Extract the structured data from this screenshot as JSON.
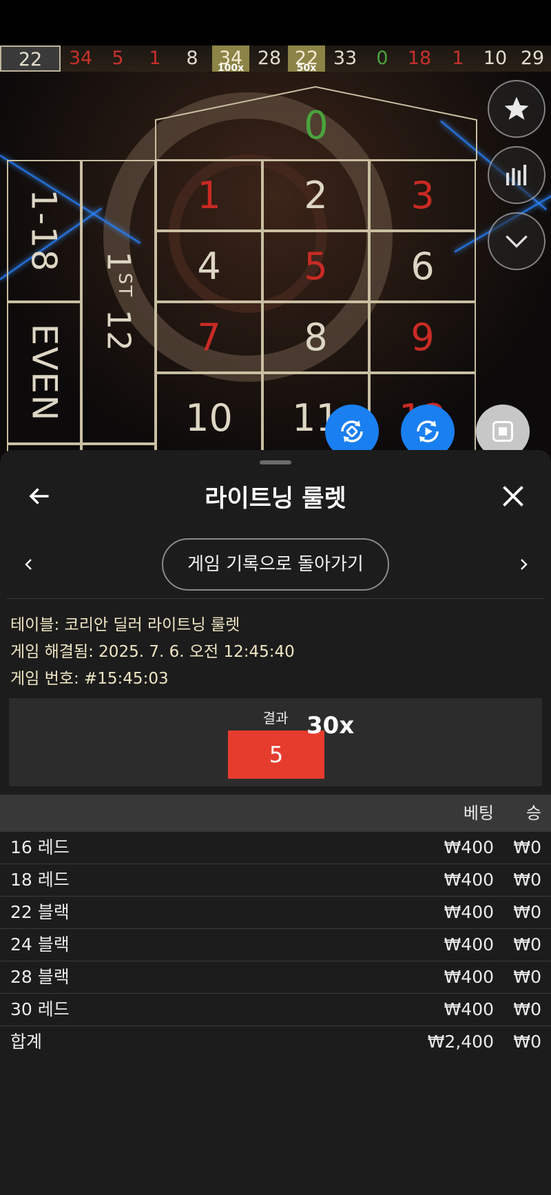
{
  "history": [
    {
      "n": "22",
      "c": "black",
      "first": true,
      "gold": false,
      "mult": ""
    },
    {
      "n": "34",
      "c": "red",
      "first": false,
      "gold": false,
      "mult": ""
    },
    {
      "n": "5",
      "c": "red",
      "first": false,
      "gold": false,
      "mult": ""
    },
    {
      "n": "1",
      "c": "red",
      "first": false,
      "gold": false,
      "mult": ""
    },
    {
      "n": "8",
      "c": "black",
      "first": false,
      "gold": false,
      "mult": ""
    },
    {
      "n": "34",
      "c": "black",
      "first": false,
      "gold": true,
      "mult": "100x"
    },
    {
      "n": "28",
      "c": "black",
      "first": false,
      "gold": false,
      "mult": ""
    },
    {
      "n": "22",
      "c": "black",
      "first": false,
      "gold": true,
      "mult": "50x"
    },
    {
      "n": "33",
      "c": "black",
      "first": false,
      "gold": false,
      "mult": ""
    },
    {
      "n": "0",
      "c": "green",
      "first": false,
      "gold": false,
      "mult": ""
    },
    {
      "n": "18",
      "c": "red",
      "first": false,
      "gold": false,
      "mult": ""
    },
    {
      "n": "1",
      "c": "red",
      "first": false,
      "gold": false,
      "mult": ""
    },
    {
      "n": "10",
      "c": "black",
      "first": false,
      "gold": false,
      "mult": ""
    },
    {
      "n": "29",
      "c": "black",
      "first": false,
      "gold": false,
      "mult": ""
    }
  ],
  "board": {
    "zero": "0",
    "low": "1-18",
    "even": "EVEN",
    "dozen_num": "1",
    "dozen_sup": "ST",
    "dozen_rest": "12",
    "numbers": [
      {
        "n": "1",
        "c": "red"
      },
      {
        "n": "2",
        "c": "black"
      },
      {
        "n": "3",
        "c": "red"
      },
      {
        "n": "4",
        "c": "black"
      },
      {
        "n": "5",
        "c": "red"
      },
      {
        "n": "6",
        "c": "black"
      },
      {
        "n": "7",
        "c": "red"
      },
      {
        "n": "8",
        "c": "black"
      },
      {
        "n": "9",
        "c": "red"
      },
      {
        "n": "10",
        "c": "black"
      },
      {
        "n": "11",
        "c": "black"
      },
      {
        "n": "12",
        "c": "red"
      }
    ]
  },
  "panel": {
    "title": "라이트닝 룰렛",
    "back_to_history": "게임 기록으로 돌아가기",
    "table_info": "테이블: 코리안 딜러 라이트닝 룰렛",
    "resolved_info": "게임 해결됨: 2025. 7. 6. 오전 12:45:40",
    "game_no_info": "게임 번호: #15:45:03",
    "result_label": "결과",
    "result_number": "5",
    "result_multiplier": "30x",
    "col_bet": "베팅",
    "col_win": "승",
    "bets": [
      {
        "name": "16 레드",
        "bet": "₩400",
        "win": "₩0"
      },
      {
        "name": "18 레드",
        "bet": "₩400",
        "win": "₩0"
      },
      {
        "name": "22 블랙",
        "bet": "₩400",
        "win": "₩0"
      },
      {
        "name": "24 블랙",
        "bet": "₩400",
        "win": "₩0"
      },
      {
        "name": "28 블랙",
        "bet": "₩400",
        "win": "₩0"
      },
      {
        "name": "30 레드",
        "bet": "₩400",
        "win": "₩0"
      }
    ],
    "total_label": "합계",
    "total_bet": "₩2,400",
    "total_win": "₩0"
  },
  "colors": {
    "result_red": "#e63c2e",
    "fab_blue": "#1a7ff0",
    "panel_bg": "#1c1c1c"
  },
  "icons": [
    "star-icon",
    "stats-icon",
    "chevron-down-icon",
    "autoplay-icon",
    "replay-icon",
    "stop-icon",
    "arrow-left-icon",
    "close-icon",
    "chevron-left-icon",
    "chevron-right-icon"
  ]
}
